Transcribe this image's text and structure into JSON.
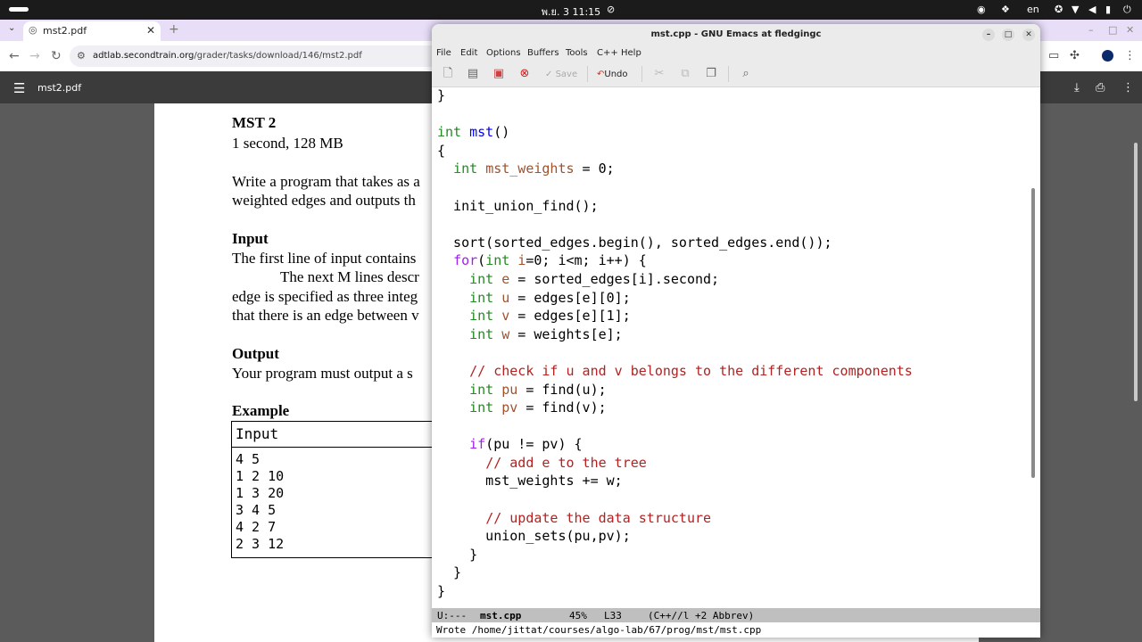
{
  "topbar": {
    "clock": "พ.ย. 3  11:15",
    "lang": "en"
  },
  "browser": {
    "tab_title": "mst2.pdf",
    "url_host": "adtlab.secondtrain.org",
    "url_path": "/grader/tasks/download/146/mst2.pdf"
  },
  "pdf": {
    "filename": "mst2.pdf",
    "title": "MST 2",
    "limits": "1 second, 128 MB",
    "intro_1": "Write a program that takes as a",
    "intro_2": "weighted edges and outputs th",
    "input_heading": "Input",
    "input_1": "The first line of input contains",
    "input_2": "The next M lines descr",
    "input_3": "edge is specified as three integ",
    "input_4": "that there is an edge between v",
    "output_heading": "Output",
    "output_1": "Your program must output a s",
    "example_heading": "Example",
    "example_input_label": "Input",
    "example_rows": [
      "4 5",
      "1 2 10",
      "1 3 20",
      "3 4 5",
      "4 2 7",
      "2 3 12"
    ]
  },
  "emacs": {
    "title": "mst.cpp - GNU Emacs at fledgingc",
    "menu": [
      "File",
      "Edit",
      "Options",
      "Buffers",
      "Tools",
      "C++",
      "Help"
    ],
    "toolbar": {
      "save": "Save",
      "undo": "Undo"
    },
    "modeline": {
      "state": "U:---",
      "buffer": "mst.cpp",
      "percent": "45%",
      "line": "L33",
      "mode": "(C++//l +2 Abbrev)"
    },
    "minibuffer": "Wrote /home/jittat/courses/algo-lab/67/prog/mst/mst.cpp"
  }
}
